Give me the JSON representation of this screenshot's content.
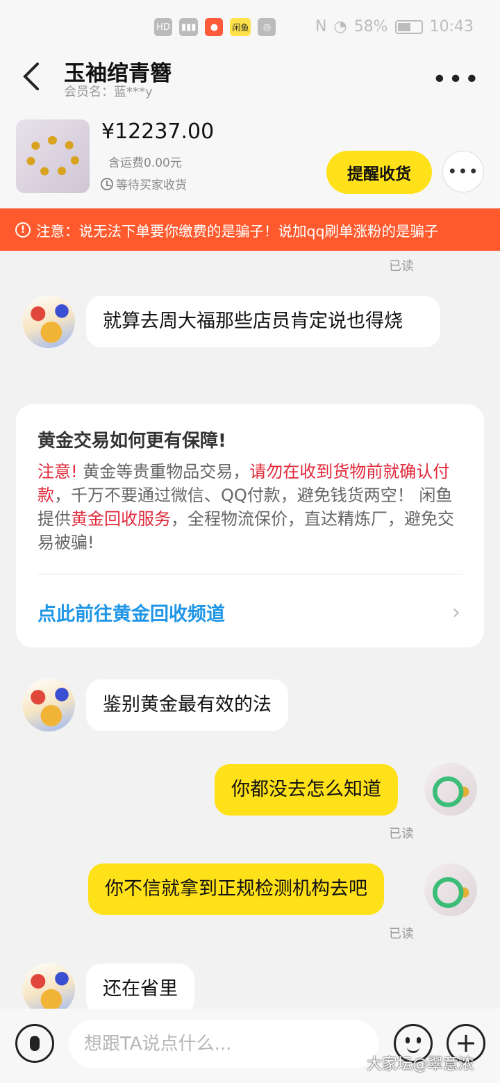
{
  "status_bar": {
    "left_icons": [
      "hd-icon",
      "signal-icon",
      "xiaohongshu-icon",
      "xianyu-icon",
      "camera-icon"
    ],
    "chip_xianyu": "闲鱼",
    "battery": "58%",
    "time": "10:43"
  },
  "header": {
    "title": "玉袖绾青簪",
    "member": "会员名：蓝***y"
  },
  "product": {
    "price": "¥12237.00",
    "shipping": "含运费0.00元",
    "status": "等待买家收货",
    "remind_button": "提醒收货"
  },
  "warning": {
    "text": "注意：说无法下单要你缴费的是骗子！说加qq刷单涨粉的是骗子"
  },
  "chat": {
    "read_label": "已读",
    "msg1": "就算去周大福那些店员肯定说也得烧",
    "msg2": "鉴别黄金最有效的法",
    "msg3": "你都没去怎么知道",
    "msg4": "你不信就拿到正规检测机构去吧",
    "msg5": "还在省里"
  },
  "info_card": {
    "title": "黄金交易如何更有保障!",
    "p1": "注意!",
    "p2": " 黄金等贵重物品交易，",
    "p3": "请勿在收到货物前就确认付款",
    "p4": "，千万不要通过微信、QQ付款，避免钱货两空！ 闲鱼提供",
    "p5": "黄金回收服务",
    "p6": "，全程物流保价，直达精炼厂，避免交易被骗!",
    "link": "点此前往黄金回收频道"
  },
  "input_bar": {
    "placeholder": "想跟TA说点什么...",
    "watermark": "大家坛@翠意浓"
  },
  "colors": {
    "accent_yellow": "#ffe11a",
    "warning_orange": "#ff5a2d",
    "link_blue": "#1e95e6",
    "alert_red": "#e0293a"
  }
}
